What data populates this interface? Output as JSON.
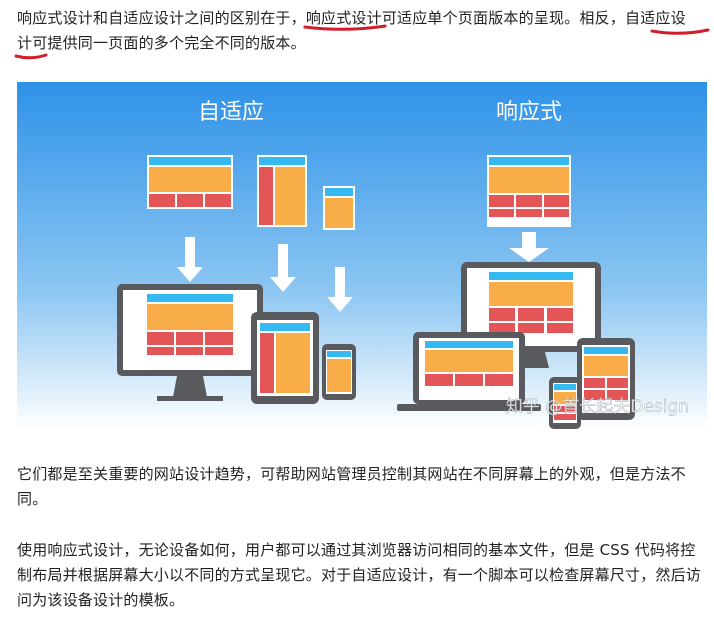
{
  "article": {
    "p1": {
      "part1": "响应式设计和自适应设计之间的区别在于，",
      "hl1": "响应式设计",
      "part2": "可适应单个页面版本的呈现。相反，",
      "hl2": "自适应设计",
      "part3": "可提供同一页面的多个完全不同的版本。"
    },
    "p2": "它们都是至关重要的网站设计趋势，可帮助网站管理员控制其网站在不同屏幕上的外观，但是方法不同。",
    "p3": "使用响应式设计，无论设备如何，用户都可以通过其浏览器访问相同的基本文件，但是 CSS 代码将控制布局并根据屏幕大小以不同的方式呈现它。对于自适应设计，有一个脚本可以检查屏幕尺寸，然后访问为该设备设计的模板。"
  },
  "figure": {
    "left_label": "自适应",
    "right_label": "响应式",
    "watermark": "知乎 @首长起夫Design"
  },
  "colors": {
    "underline": "#d21e2b",
    "sky_top": "#2e92e8",
    "sky_bottom": "#ffffff",
    "header_blue": "#36b8f0",
    "content_orange": "#f9ad48",
    "footer_red": "#e45557",
    "device_gray": "#585a5e",
    "arrow_white": "#ffffff"
  }
}
